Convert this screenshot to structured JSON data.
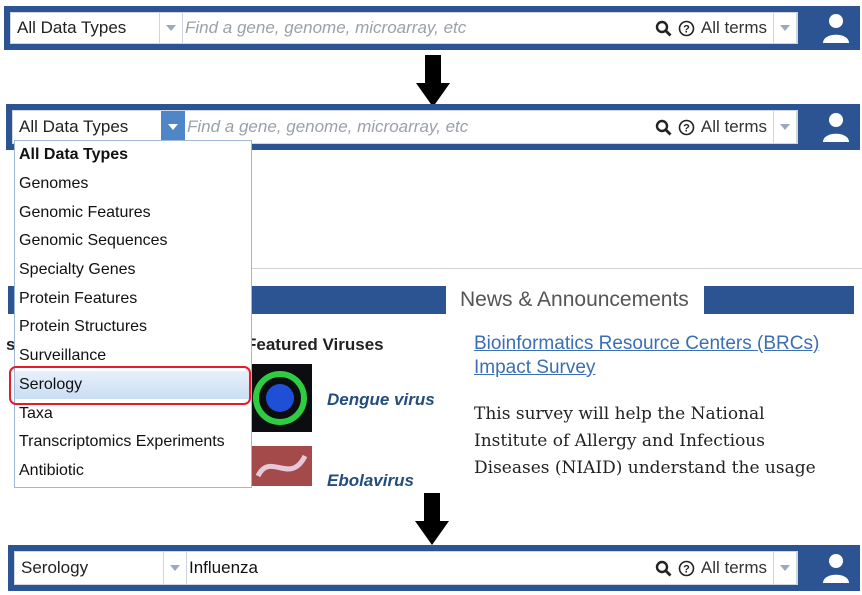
{
  "toolbar_top": {
    "data_type": "All Data Types",
    "search_placeholder": "Find a gene, genome, microarray, etc",
    "terms_label": "All terms"
  },
  "toolbar_mid": {
    "data_type": "All Data Types",
    "search_placeholder": "Find a gene, genome, microarray, etc",
    "terms_label": "All terms"
  },
  "dropdown": {
    "items": [
      "All Data Types",
      "Genomes",
      "Genomic Features",
      "Genomic Sequences",
      "Specialty Genes",
      "Protein Features",
      "Protein Structures",
      "Surveillance",
      "Serology",
      "Taxa",
      "Transcriptomics Experiments",
      "Antibiotic"
    ],
    "selected": "Serology"
  },
  "background_page": {
    "news_title": "News & Announcements",
    "featured_title": "Featured Viruses",
    "featured_prefix": "s",
    "viruses": [
      "Dengue virus",
      "Ebolavirus"
    ],
    "news_link_line1": "Bioinformatics Resource Centers (BRCs)",
    "news_link_line2": "Impact Survey",
    "news_body_line1": "This survey will help the National",
    "news_body_line2": "Institute of Allergy and Infectious",
    "news_body_line3": "Diseases (NIAID) understand the usage"
  },
  "toolbar_bottom": {
    "data_type": "Serology",
    "search_value": "Influenza",
    "terms_label": "All terms"
  },
  "colors": {
    "bar": "#2d5492",
    "caret_active": "#4f86c8",
    "highlight_box": "#e8192a",
    "link": "#3a6fb3"
  }
}
